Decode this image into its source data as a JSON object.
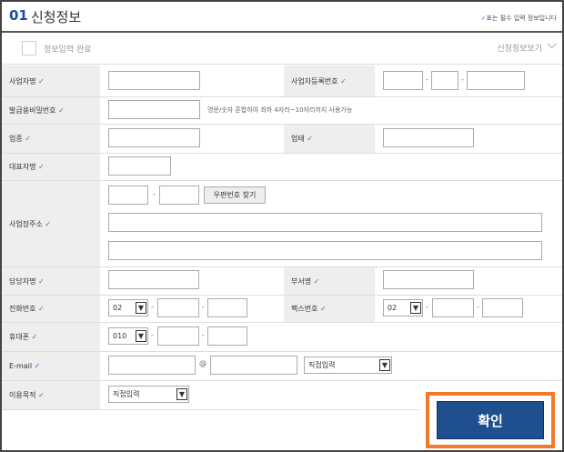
{
  "header": {
    "number": "01",
    "title": "신청정보",
    "required_note": "표는 필수 입력 정보입니다"
  },
  "subheader": {
    "complete_label": "정보입력 완료",
    "view_label": "신청정보보기"
  },
  "fields": {
    "business_name": "사업자명",
    "business_reg_no": "사업자등록번호",
    "issue_password": "발급용비밀번호",
    "password_note": "영문/숫자 혼합하여 최하 4자리~10자리까지 사용가능",
    "business_type": "업종",
    "business_category": "업태",
    "ceo_name": "대표자명",
    "business_address": "사업장주소",
    "postcode_button": "우편번호 찾기",
    "manager_name": "담당자명",
    "department": "부서명",
    "phone": "전화번호",
    "phone_prefix": "02",
    "fax": "팩스번호",
    "fax_prefix": "02",
    "mobile": "휴대폰",
    "mobile_prefix": "010",
    "email": "E-mail",
    "email_at": "@",
    "email_domain_select": "직접입력",
    "purpose": "이용목적",
    "purpose_select": "직접입력"
  },
  "confirm_button": "확인",
  "colors": {
    "accent": "#1e4f9c",
    "highlight": "#f07a2a",
    "button": "#1f4f8f"
  }
}
